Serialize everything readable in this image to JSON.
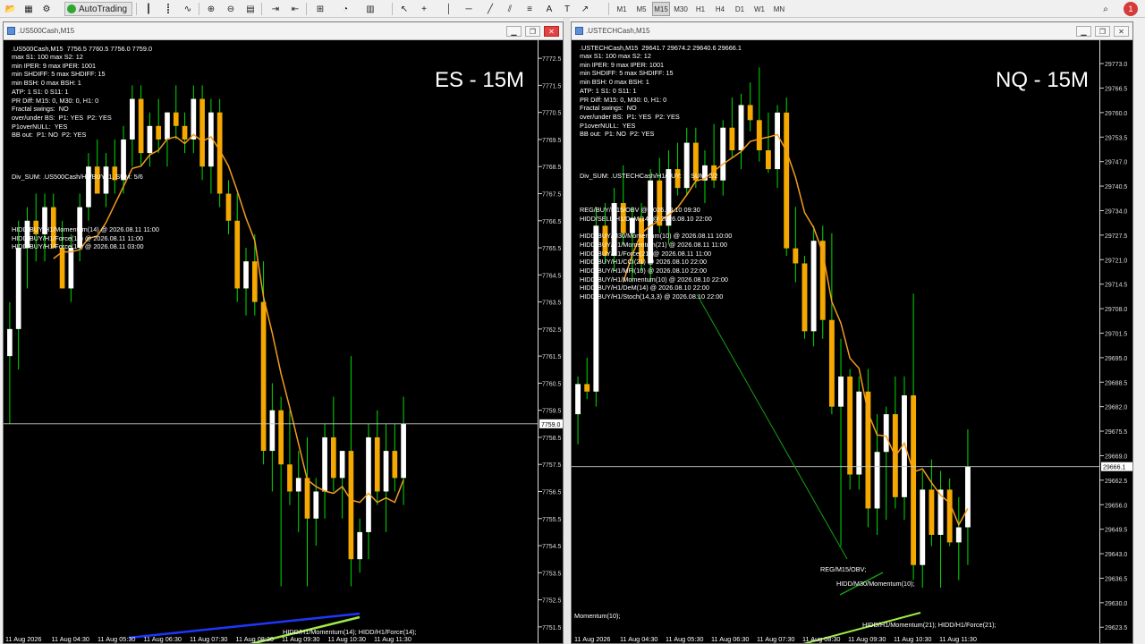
{
  "toolbar": {
    "autotrading_label": "AutoTrading",
    "timeframes": [
      "M1",
      "M5",
      "M15",
      "M30",
      "H1",
      "H4",
      "D1",
      "W1",
      "MN"
    ],
    "active_timeframe": "M15",
    "notification_count": "1"
  },
  "colors": {
    "bull": "#ffffff",
    "bear": "#f5a800",
    "wick": "#00dd00",
    "ma": "#f39c20",
    "div_blue": "#1e37ff",
    "div_green": "#9ee84a",
    "trend_green": "#15a015"
  },
  "left": {
    "title": ".US500Cash,M15",
    "header": ".US500Cash,M15  7756.5 7760.5 7756.0 7759.0",
    "big_label": "ES - 15M",
    "info_lines": [
      "max S1: 100 max S2: 12",
      "min IPER: 9 max IPER: 1001",
      "min SHDIFF: 5 max SHDIFF: 15",
      "min BSH: 0 max BSH: 1",
      "ATP: 1 S1: 0 S11: 1",
      "PR Diff: M15: 0, M30: 0, H1: 0",
      "Fractal swings:  NO",
      "over/under BS:  P1: YES  P2: YES",
      "P1overNULL:  YES",
      "BB out:  P1: NO  P2: YES"
    ],
    "div_sum": "Div_SUM: .US500Cash/H1/BUY: 1, SUM: 5/6",
    "signals": [
      "HIDD/BUY/H1/Momentum(14) @ 2026.08.11 11:00",
      "HIDD/BUY/H1/Force(14) @ 2026.08.11 11:00",
      "HIDD/BUY/H1/Force(14) @ 2026.08.11 03:00"
    ],
    "bottom_annotation": "HIDD/H1/Momentum(14); HIDD/H1/Force(14);",
    "price_ticks": [
      "7772.5",
      "7771.5",
      "7770.5",
      "7769.5",
      "7768.5",
      "7767.5",
      "7766.5",
      "7765.5",
      "7764.5",
      "7763.5",
      "7762.5",
      "7761.5",
      "7760.5",
      "7759.5",
      "7758.5",
      "7757.5",
      "7756.5",
      "7755.5",
      "7754.5",
      "7753.5",
      "7752.5",
      "7751.5"
    ],
    "current_price": "7759.0",
    "time_ticks": [
      "11 Aug 2026",
      "11 Aug 04:30",
      "11 Aug 05:30",
      "11 Aug 06:30",
      "11 Aug 07:30",
      "11 Aug 08:30",
      "11 Aug 09:30",
      "11 Aug 10:30",
      "11 Aug 11:30"
    ]
  },
  "right": {
    "title": ".USTECHCash,M15",
    "header": ".USTECHCash,M15  29641.7 29674.2 29640.6 29666.1",
    "big_label": "NQ - 15M",
    "info_lines": [
      "max S1: 100 max S2: 12",
      "min IPER: 9 max IPER: 1001",
      "min SHDIFF: 5 max SHDIFF: 15",
      "min BSH: 0 max BSH: 1",
      "ATP: 1 S1: 0 S11: 1",
      "PR Diff: M15: 0, M30: 0, H1: 0",
      "Fractal swings:  NO",
      "over/under BS:  P1: YES  P2: YES",
      "P1overNULL:  YES",
      "BB out:  P1: NO  P2: YES"
    ],
    "div_sum": "Div_SUM: .USTECHCash/H1/BUY: 1, SUM: 2/2",
    "signals": [
      "REG/BUY/M15/OBV @ 2026.08.10 09:30",
      "HIDD/SELL/H1/DeM(14) @ 2026.08.10 22:00",
      "",
      "HIDD/BUY/M30/Momentum(10) @ 2026.08.11 10:00",
      "HIDD/BUY/H1/Momentum(21) @ 2026.08.11 11:00",
      "HIDD/BUY/H1/Force(21) @ 2026.08.11 11:00",
      "HIDD/BUY/H1/CCI(21) @ 2026.08.10 22:00",
      "HIDD/BUY/H1/MFI(10) @ 2026.08.10 22:00",
      "HIDD/BUY/H1/Momentum(10) @ 2026.08.10 22:00",
      "HIDD/BUY/H1/DeM(14) @ 2026.08.10 22:00",
      "HIDD/BUY/H1/Stoch(14,3,3) @ 2026.08.10 22:00"
    ],
    "annotations": [
      "REG/M15/OBV;",
      "HIDD/M30/Momentum(10);",
      "Momentum(10);",
      "HIDD/H1/Momentum(21); HIDD/H1/Force(21);"
    ],
    "price_ticks": [
      "29773.0",
      "29766.5",
      "29760.0",
      "29753.5",
      "29747.0",
      "29740.5",
      "29734.0",
      "29727.5",
      "29721.0",
      "29714.5",
      "29708.0",
      "29701.5",
      "29695.0",
      "29688.5",
      "29682.0",
      "29675.5",
      "29669.0",
      "29662.5",
      "29656.0",
      "29649.5",
      "29643.0",
      "29636.5",
      "29630.0",
      "29623.5"
    ],
    "current_price": "29666.1",
    "time_ticks": [
      "11 Aug 2026",
      "11 Aug 04:30",
      "11 Aug 05:30",
      "11 Aug 06:30",
      "11 Aug 07:30",
      "11 Aug 08:30",
      "11 Aug 09:30",
      "11 Aug 10:30",
      "11 Aug 11:30"
    ]
  },
  "chart_data": [
    {
      "type": "candlestick",
      "title": ".US500Cash,M15",
      "ylim": [
        7751.0,
        7773.0
      ],
      "ohlc": [
        [
          7761.5,
          7763.5,
          7759.0,
          7762.5
        ],
        [
          7762.5,
          7766.5,
          7761.0,
          7765.5
        ],
        [
          7765.5,
          7767.0,
          7764.0,
          7766.5
        ],
        [
          7766.5,
          7767.5,
          7765.0,
          7766.0
        ],
        [
          7766.0,
          7767.5,
          7765.0,
          7767.0
        ],
        [
          7767.0,
          7767.5,
          7765.5,
          7765.5
        ],
        [
          7765.5,
          7766.5,
          7764.0,
          7764.0
        ],
        [
          7764.0,
          7766.0,
          7763.5,
          7765.5
        ],
        [
          7765.5,
          7767.5,
          7765.0,
          7767.0
        ],
        [
          7767.0,
          7769.0,
          7766.5,
          7768.5
        ],
        [
          7768.5,
          7769.5,
          7767.5,
          7767.5
        ],
        [
          7767.5,
          7769.0,
          7767.0,
          7768.5
        ],
        [
          7768.5,
          7769.5,
          7767.5,
          7768.0
        ],
        [
          7768.0,
          7770.0,
          7767.5,
          7769.5
        ],
        [
          7769.5,
          7771.5,
          7768.5,
          7771.0
        ],
        [
          7771.0,
          7771.5,
          7768.5,
          7769.0
        ],
        [
          7769.0,
          7770.5,
          7768.5,
          7770.0
        ],
        [
          7770.0,
          7771.0,
          7769.0,
          7769.5
        ],
        [
          7769.5,
          7770.5,
          7768.5,
          7770.5
        ],
        [
          7770.5,
          7771.5,
          7769.5,
          7770.0
        ],
        [
          7770.0,
          7770.5,
          7769.0,
          7769.5
        ],
        [
          7769.5,
          7771.5,
          7769.0,
          7771.0
        ],
        [
          7771.0,
          7771.5,
          7768.0,
          7768.5
        ],
        [
          7768.5,
          7771.0,
          7767.5,
          7770.5
        ],
        [
          7770.5,
          7771.0,
          7767.0,
          7767.5
        ],
        [
          7767.5,
          7768.0,
          7766.0,
          7766.5
        ],
        [
          7766.5,
          7767.5,
          7763.5,
          7764.0
        ],
        [
          7764.0,
          7765.5,
          7763.0,
          7765.0
        ],
        [
          7765.0,
          7766.0,
          7763.0,
          7763.5
        ],
        [
          7763.5,
          7765.0,
          7757.5,
          7758.0
        ],
        [
          7758.0,
          7760.5,
          7756.5,
          7759.5
        ],
        [
          7759.5,
          7760.0,
          7753.0,
          7757.5
        ],
        [
          7757.5,
          7759.5,
          7756.0,
          7756.5
        ],
        [
          7756.5,
          7758.0,
          7755.0,
          7757.0
        ],
        [
          7757.0,
          7758.5,
          7753.0,
          7755.5
        ],
        [
          7755.5,
          7757.0,
          7754.5,
          7756.5
        ],
        [
          7756.5,
          7759.0,
          7755.5,
          7758.5
        ],
        [
          7758.5,
          7760.0,
          7756.5,
          7757.0
        ],
        [
          7757.0,
          7758.0,
          7755.5,
          7758.0
        ],
        [
          7758.0,
          7761.5,
          7753.0,
          7754.0
        ],
        [
          7754.0,
          7755.5,
          7753.5,
          7755.0
        ],
        [
          7755.0,
          7759.0,
          7754.0,
          7758.5
        ],
        [
          7758.5,
          7759.5,
          7756.0,
          7756.5
        ],
        [
          7756.5,
          7759.0,
          7755.0,
          7758.0
        ],
        [
          7758.0,
          7759.0,
          7756.5,
          7757.0
        ],
        [
          7757.0,
          7760.0,
          7756.0,
          7759.0
        ]
      ]
    },
    {
      "type": "candlestick",
      "title": ".USTECHCash,M15",
      "ylim": [
        7751.0,
        7773.0
      ],
      "ohlc": [
        [
          29680.0,
          29690.0,
          29672.0,
          29688.0
        ],
        [
          29688.0,
          29695.0,
          29684.0,
          29686.0
        ],
        [
          29686.0,
          29735.0,
          29682.0,
          29730.0
        ],
        [
          29730.0,
          29736.0,
          29720.0,
          29722.0
        ],
        [
          29722.0,
          29740.0,
          29718.0,
          29736.0
        ],
        [
          29736.0,
          29746.0,
          29725.0,
          29728.0
        ],
        [
          29728.0,
          29735.0,
          29715.0,
          29732.0
        ],
        [
          29732.0,
          29736.0,
          29718.0,
          29720.0
        ],
        [
          29720.0,
          29745.0,
          29715.0,
          29742.0
        ],
        [
          29742.0,
          29748.0,
          29728.0,
          29730.0
        ],
        [
          29730.0,
          29750.0,
          29725.0,
          29745.0
        ],
        [
          29745.0,
          29752.0,
          29738.0,
          29740.0
        ],
        [
          29740.0,
          29756.0,
          29738.0,
          29752.0
        ],
        [
          29752.0,
          29756.0,
          29740.0,
          29742.0
        ],
        [
          29742.0,
          29750.0,
          29736.0,
          29746.0
        ],
        [
          29746.0,
          29757.0,
          29740.0,
          29742.0
        ],
        [
          29742.0,
          29758.0,
          29738.0,
          29756.0
        ],
        [
          29756.0,
          29764.0,
          29748.0,
          29750.0
        ],
        [
          29750.0,
          29765.0,
          29745.0,
          29762.0
        ],
        [
          29762.0,
          29768.0,
          29755.0,
          29758.0
        ],
        [
          29758.0,
          29772.0,
          29747.0,
          29750.0
        ],
        [
          29750.0,
          29760.0,
          29744.0,
          29745.0
        ],
        [
          29745.0,
          29762.0,
          29740.0,
          29760.0
        ],
        [
          29760.0,
          29764.0,
          29722.0,
          29724.0
        ],
        [
          29724.0,
          29735.0,
          29715.0,
          29720.0
        ],
        [
          29720.0,
          29722.0,
          29700.0,
          29702.0
        ],
        [
          29702.0,
          29730.0,
          29698.0,
          29726.0
        ],
        [
          29726.0,
          29730.0,
          29700.0,
          29705.0
        ],
        [
          29705.0,
          29728.0,
          29680.0,
          29682.0
        ],
        [
          29682.0,
          29700.0,
          29645.0,
          29690.0
        ],
        [
          29690.0,
          29692.0,
          29660.0,
          29664.0
        ],
        [
          29664.0,
          29690.0,
          29660.0,
          29686.0
        ],
        [
          29686.0,
          29692.0,
          29650.0,
          29655.0
        ],
        [
          29655.0,
          29680.0,
          29648.0,
          29670.0
        ],
        [
          29670.0,
          29682.0,
          29652.0,
          29680.0
        ],
        [
          29680.0,
          29690.0,
          29655.0,
          29658.0
        ],
        [
          29658.0,
          29690.0,
          29652.0,
          29685.0
        ],
        [
          29685.0,
          29712.0,
          29636.0,
          29640.0
        ],
        [
          29640.0,
          29665.0,
          29634.0,
          29660.0
        ],
        [
          29660.0,
          29668.0,
          29645.0,
          29648.0
        ],
        [
          29648.0,
          29665.0,
          29634.0,
          29660.0
        ],
        [
          29660.0,
          29663.0,
          29645.0,
          29646.0
        ],
        [
          29646.0,
          29658.0,
          29636.0,
          29650.0
        ],
        [
          29650.0,
          29676.0,
          29640.0,
          29666.1
        ]
      ]
    }
  ]
}
